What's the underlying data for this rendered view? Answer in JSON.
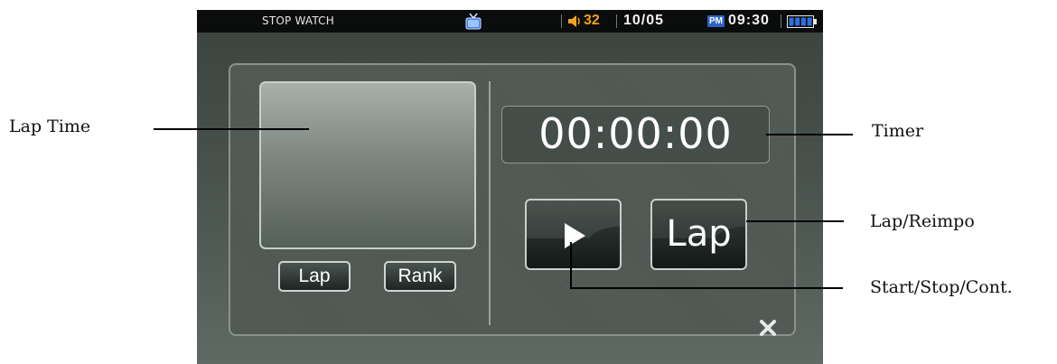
{
  "status_bar": {
    "title": "STOP WATCH",
    "volume": "32",
    "date": "10/05",
    "ampm": "PM",
    "time": "09:30",
    "icons": [
      "tv-icon",
      "speaker-icon",
      "battery-icon"
    ]
  },
  "stopwatch": {
    "timer": "00:00:00",
    "lap_small_label": "Lap",
    "rank_label": "Rank",
    "lap_button_label": "Lap",
    "start_icon": "play-icon",
    "close_icon": "close-icon"
  },
  "callouts": {
    "lap_time": "Lap Time",
    "timer": "Timer",
    "lap_reimpo": "Lap/Reimpo",
    "start_stop": "Start/Stop/Cont."
  },
  "colors": {
    "volume": "#f4a21a",
    "pm_badge": "#2a64c6",
    "battery": "#2f6fe0"
  }
}
